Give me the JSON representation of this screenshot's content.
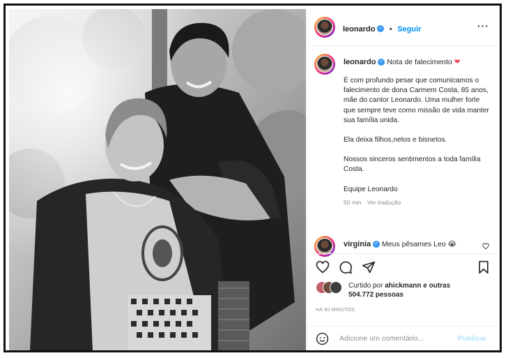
{
  "header": {
    "username": "leonardo",
    "separator": "•",
    "follow_label": "Seguir",
    "more_label": "···"
  },
  "caption": {
    "username": "leonardo",
    "title": "Nota de falecimento",
    "emoji": "❤",
    "paragraphs": [
      "É com profundo pesar que comunicamos o falecimento de dona Carmem Costa, 85 anos, mãe do cantor Leonardo. Uma mulher forte que sempre teve como missão de vida manter sua família unida.",
      "Ela deixa filhos,netos e bisnetos.",
      "Nossos sinceros sentimentos a toda família Costa.",
      "Equipe Leonardo"
    ],
    "time": "50 min",
    "translate": "Ver tradução"
  },
  "comment": {
    "username": "virginia",
    "text": "Meus pêsames Leo",
    "emoji": "😭"
  },
  "likes": {
    "prefix": "Curtido por",
    "user": "ahickmann",
    "connector": "e outras",
    "count": "504.772 pessoas"
  },
  "timestamp": "HÁ 50 MINUTOS",
  "add_comment": {
    "placeholder": "Adicione um comentário...",
    "publish_label": "Publicar"
  },
  "colors": {
    "link": "#0095f6",
    "heart": "#ed4956",
    "verified": "#3897f0",
    "muted": "#8e8e8e"
  },
  "icons": [
    "heart-icon",
    "comment-icon",
    "share-icon",
    "bookmark-icon",
    "emoji-icon",
    "verified-icon"
  ]
}
